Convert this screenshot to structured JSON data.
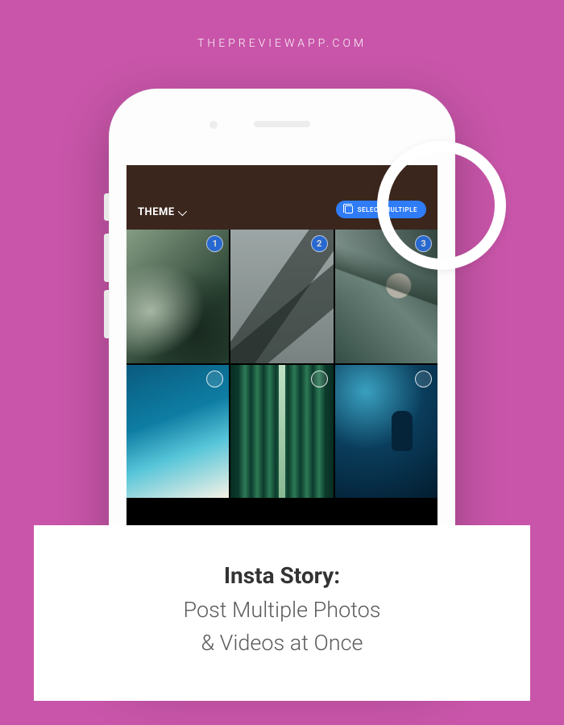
{
  "watermark": "THEPREVIEWAPP.COM",
  "topbar": {
    "dropdown_label": "THEME",
    "select_button": "SELECT MULTIPLE"
  },
  "tiles": [
    {
      "selected": true,
      "order": "1"
    },
    {
      "selected": true,
      "order": "2"
    },
    {
      "selected": true,
      "order": "3"
    },
    {
      "selected": false
    },
    {
      "selected": false
    },
    {
      "selected": false
    }
  ],
  "caption": {
    "title": "Insta Story:",
    "line1": "Post Multiple Photos",
    "line2": "& Videos at Once"
  },
  "colors": {
    "background": "#c855a9",
    "accent": "#2f7cf6",
    "topbar": "#3b261d"
  }
}
